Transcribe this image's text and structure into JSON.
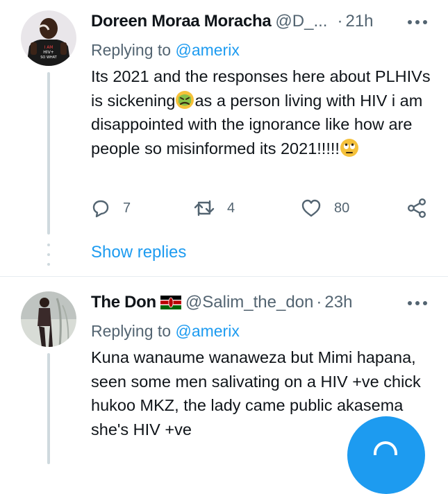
{
  "tweets": [
    {
      "author_name": "Doreen Moraa Moracha",
      "author_handle": "@D_...",
      "time": "21h",
      "separator": "·",
      "replying_prefix": "Replying to",
      "replying_to": "@amerix",
      "text_parts": [
        "Its 2021 and the responses here about PLHIVs is sickening",
        "as a person living with HIV i am disappointed with the ignorance like how are people so misinformed its 2021!!!!!"
      ],
      "emojis": [
        "nauseated-face",
        "face-with-rolling-eyes"
      ],
      "replies": "7",
      "retweets": "4",
      "likes": "80",
      "avatar_text": "I AM HIV+ SO WHAT"
    },
    {
      "author_name": "The Don",
      "author_handle": "@Salim_the_don",
      "time": "23h",
      "separator": "·",
      "flag": "kenya-flag",
      "replying_prefix": "Replying to",
      "replying_to": "@amerix",
      "text": "Kuna wanaume wanaweza but Mimi hapana, seen some men salivating on a HIV +ve chick hukoo MKZ, the lady came public akasema she's HIV +ve"
    }
  ],
  "show_replies": "Show replies",
  "colors": {
    "accent": "#1d9bf0",
    "secondary_text": "#536471",
    "primary_text": "#0f1419",
    "thread_line": "#cfd9de"
  }
}
